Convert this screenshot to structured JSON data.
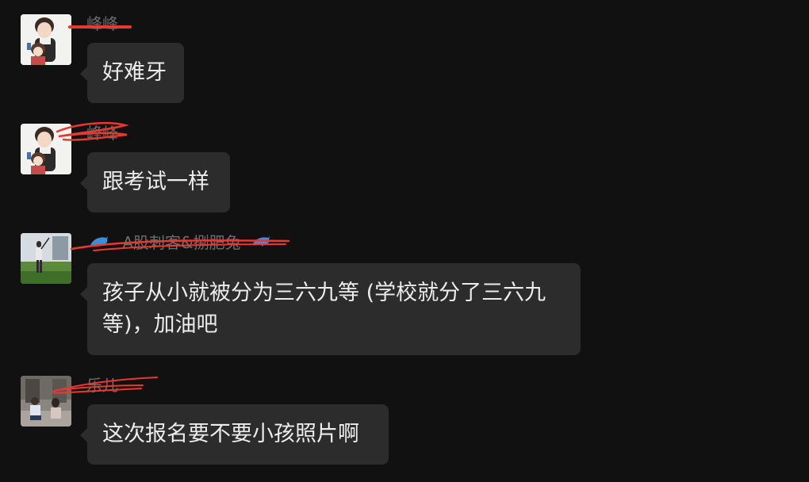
{
  "messages": [
    {
      "sender": "峰峰",
      "avatar": "anime-couple-avatar",
      "text": "好难牙"
    },
    {
      "sender": "峰峰",
      "avatar": "anime-couple-avatar",
      "text": "跟考试一样"
    },
    {
      "sender": "A股刺客&捌肥兔",
      "sender_icons": [
        "dolphin-icon",
        "dolphin-icon"
      ],
      "avatar": "golfer-avatar",
      "text_line1": "孩子从小就被分为三六九等 (学校就分了三六九",
      "text_line2": "等)，加油吧"
    },
    {
      "sender": "乐儿",
      "avatar": "couple-photo-avatar",
      "text": "这次报名要不要小孩照片啊"
    }
  ],
  "colors": {
    "background": "#111111",
    "bubble": "#2c2c2c",
    "message_text": "#ececec",
    "sender_text": "#6d6d6d",
    "redaction": "#e8382f"
  }
}
